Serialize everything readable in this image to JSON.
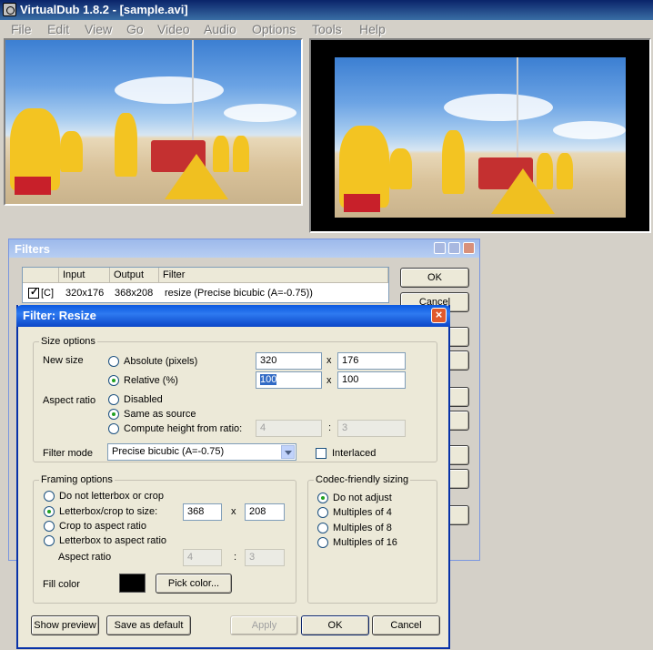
{
  "main": {
    "title": "VirtualDub 1.8.2 - [sample.avi]",
    "menu": [
      "File",
      "Edit",
      "View",
      "Go",
      "Video",
      "Audio",
      "Options",
      "Tools",
      "Help"
    ]
  },
  "filters": {
    "title": "Filters",
    "columns": [
      "Input",
      "Output",
      "Filter"
    ],
    "row": {
      "flag": "[C]",
      "input": "320x176",
      "output": "368x208",
      "filter": "resize (Precise bicubic (A=-0.75))"
    },
    "ok_label": "OK",
    "cancel_label": "Cancel"
  },
  "resize": {
    "title": "Filter: Resize",
    "size_options": {
      "label": "Size options",
      "new_size_label": "New size",
      "absolute_label": "Absolute (pixels)",
      "relative_label": "Relative (%)",
      "abs_w": "320",
      "abs_h": "176",
      "rel_w": "100",
      "rel_h": "100",
      "x": "x",
      "aspect_label": "Aspect ratio",
      "disabled_label": "Disabled",
      "same_label": "Same as source",
      "compute_label": "Compute height from ratio:",
      "ratio_a": "4",
      "ratio_b": "3",
      "colon": ":",
      "filter_mode_label": "Filter mode",
      "filter_mode_value": "Precise bicubic (A=-0.75)",
      "interlaced_label": "Interlaced"
    },
    "framing": {
      "label": "Framing options",
      "no_letterbox": "Do not letterbox or crop",
      "letterbox_crop": "Letterbox/crop to size:",
      "lb_w": "368",
      "lb_h": "208",
      "crop_aspect": "Crop to aspect ratio",
      "letterbox_aspect": "Letterbox to aspect ratio",
      "aspect_label": "Aspect ratio",
      "asp_a": "4",
      "asp_b": "3",
      "fill_label": "Fill color",
      "pick_label": "Pick color...",
      "fill_color": "#000000"
    },
    "codec": {
      "label": "Codec-friendly sizing",
      "options": [
        "Do not adjust",
        "Multiples of 4",
        "Multiples of 8",
        "Multiples of 16"
      ]
    },
    "buttons": {
      "preview": "Show preview",
      "save_default": "Save as default",
      "apply": "Apply",
      "ok": "OK",
      "cancel": "Cancel"
    }
  }
}
